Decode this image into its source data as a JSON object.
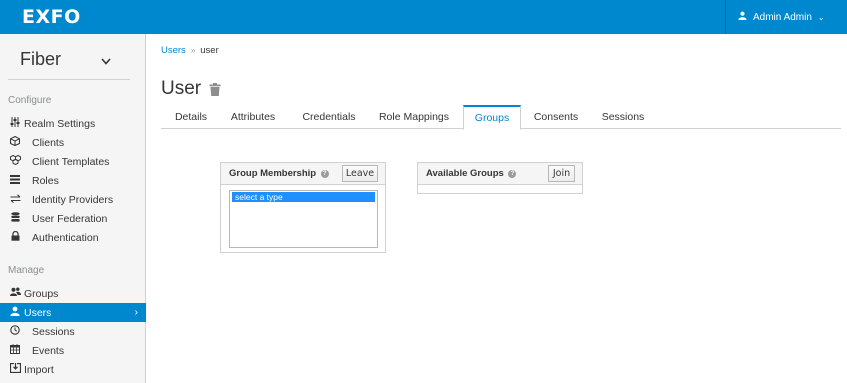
{
  "header": {
    "logo": "EXFO",
    "user": "Admin Admin"
  },
  "sidebar": {
    "realm": "Fiber",
    "configure_label": "Configure",
    "configure_items": [
      {
        "label": "Realm Settings",
        "icon": "sliders-icon"
      },
      {
        "label": "Clients",
        "icon": "cube-icon"
      },
      {
        "label": "Client Templates",
        "icon": "cubes-icon"
      },
      {
        "label": "Roles",
        "icon": "list-icon"
      },
      {
        "label": "Identity Providers",
        "icon": "exchange-icon"
      },
      {
        "label": "User Federation",
        "icon": "database-icon"
      },
      {
        "label": "Authentication",
        "icon": "lock-icon"
      }
    ],
    "manage_label": "Manage",
    "manage_items": [
      {
        "label": "Groups",
        "icon": "users-icon"
      },
      {
        "label": "Users",
        "icon": "user-icon"
      },
      {
        "label": "Sessions",
        "icon": "clock-icon"
      },
      {
        "label": "Events",
        "icon": "calendar-icon"
      },
      {
        "label": "Import",
        "icon": "import-icon"
      }
    ]
  },
  "breadcrumb": {
    "link": "Users",
    "sep": "»",
    "current": "user"
  },
  "page": {
    "title": "User"
  },
  "tabs": [
    "Details",
    "Attributes",
    "Credentials",
    "Role Mappings",
    "Groups",
    "Consents",
    "Sessions"
  ],
  "membership": {
    "title": "Group Membership",
    "button": "Leave",
    "selected_option": "select a type"
  },
  "available": {
    "title": "Available Groups",
    "button": "Join"
  },
  "colors": {
    "primary": "#0088ce",
    "selected_option": "#1e90ff"
  }
}
